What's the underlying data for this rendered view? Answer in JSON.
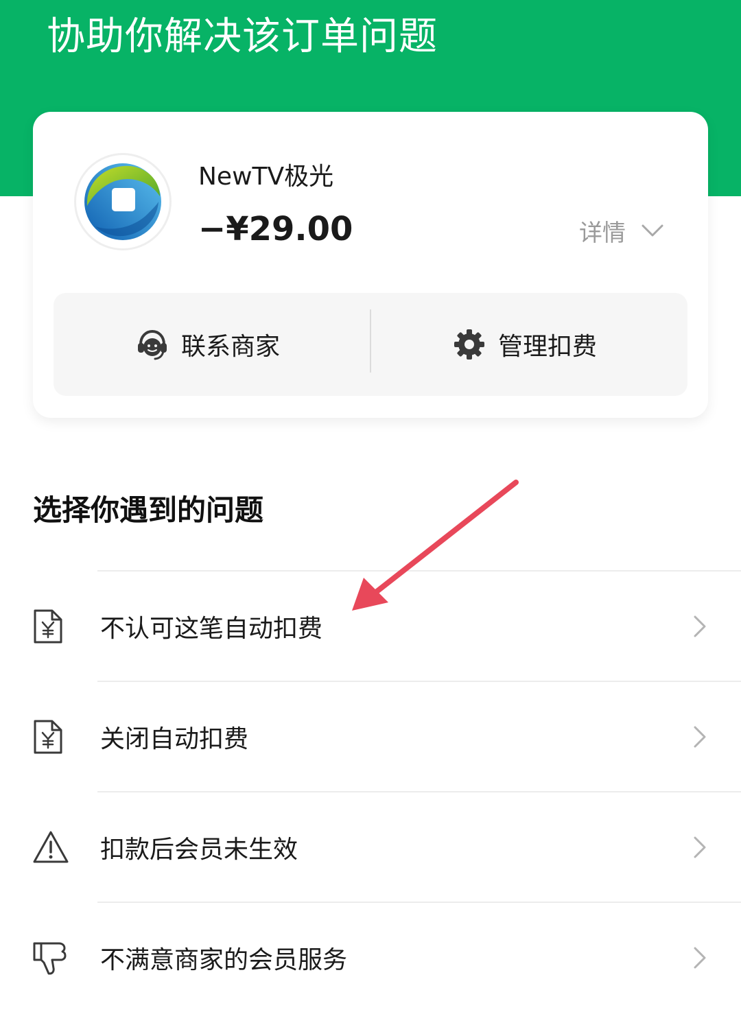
{
  "header": {
    "title": "协助你解决该订单问题",
    "bg_color": "#07b366"
  },
  "order_card": {
    "merchant_logo": "newtv-logo",
    "merchant_name": "NewTV极光",
    "amount": "−¥29.00",
    "details_label": "详情",
    "actions": [
      {
        "label": "联系商家",
        "icon": "customer-service-icon"
      },
      {
        "label": "管理扣费",
        "icon": "gear-icon"
      }
    ]
  },
  "section": {
    "title": "选择你遇到的问题"
  },
  "problems": [
    {
      "label": "不认可这笔自动扣费",
      "icon": "yuan-document-icon"
    },
    {
      "label": "关闭自动扣费",
      "icon": "yuan-document-icon"
    },
    {
      "label": "扣款后会员未生效",
      "icon": "warning-triangle-icon"
    },
    {
      "label": "不满意商家的会员服务",
      "icon": "thumbs-down-icon"
    }
  ],
  "annotation": {
    "arrow_color": "#e8485a"
  }
}
